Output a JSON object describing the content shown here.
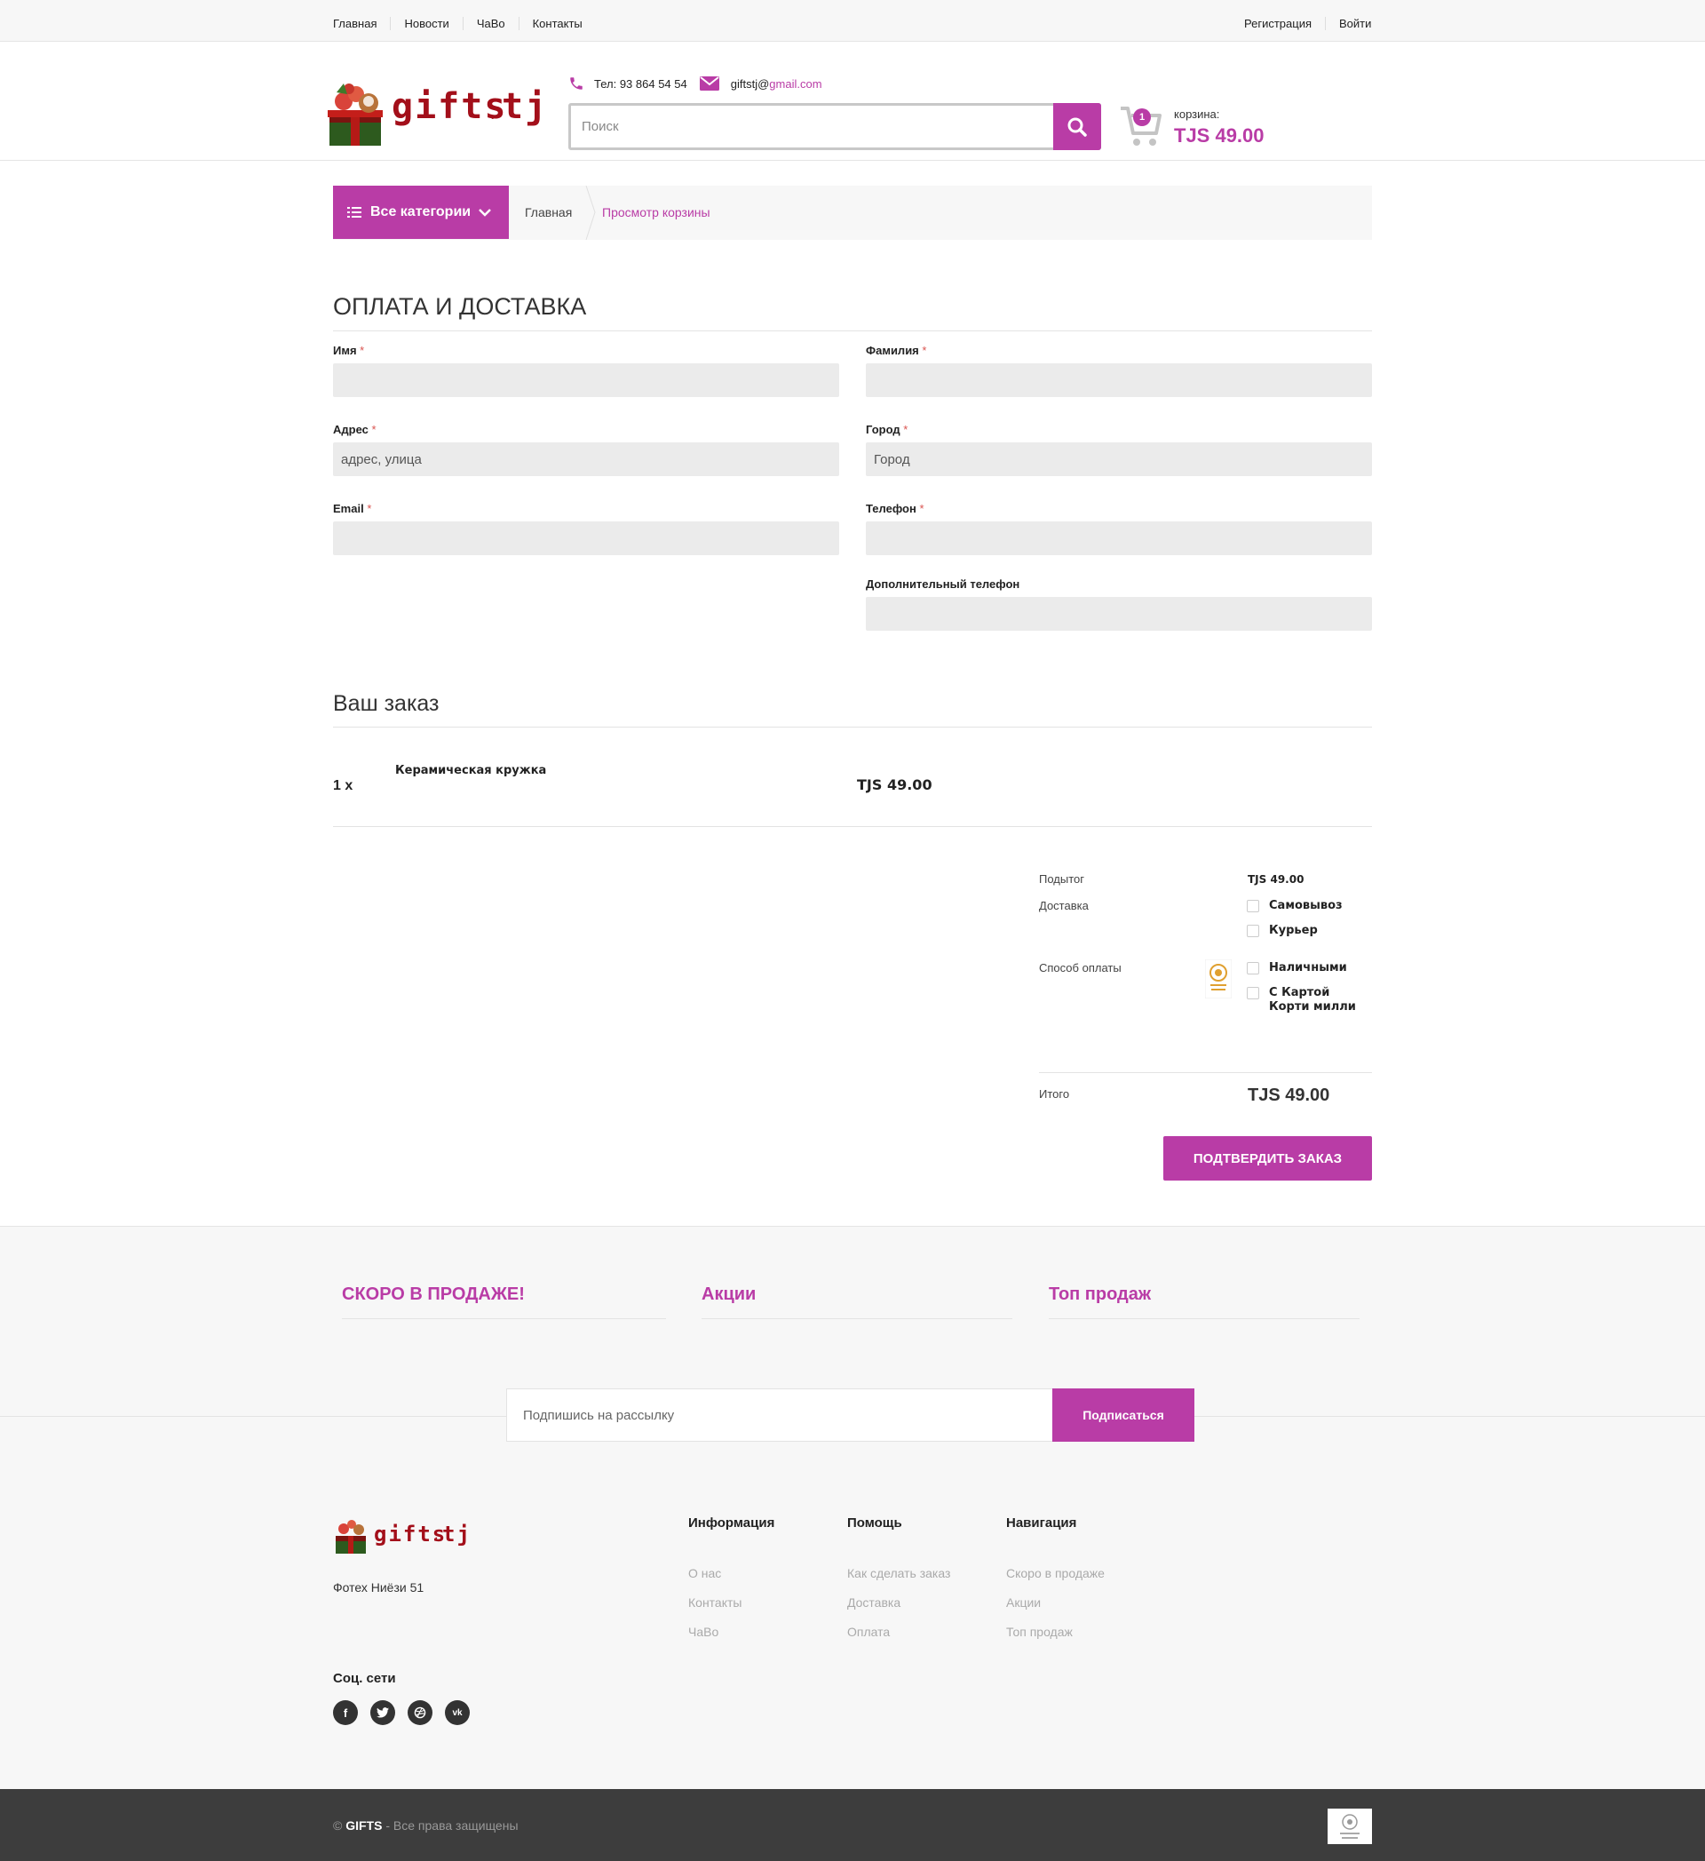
{
  "topbar": {
    "left_links": [
      "Главная",
      "Новости",
      "ЧаВо",
      "Контакты"
    ],
    "right_links": [
      "Регистрация",
      "Войти"
    ]
  },
  "header": {
    "logo_text": "gifts",
    "logo_suffix": "tj",
    "phone": "Тел: 93 864 54 54",
    "email_user": "giftstj@",
    "email_domain": "gmail.com",
    "search_placeholder": "Поиск",
    "cart_count": "1",
    "cart_label": "корзина:",
    "cart_total": "TJS 49.00"
  },
  "breadcrumb": {
    "all_categories": "Все категории",
    "home": "Главная",
    "current": "Просмотр корзины"
  },
  "checkout": {
    "title": "ОПЛАТА И ДОСТАВКА",
    "fields": {
      "first_name": {
        "label": "Имя",
        "value": ""
      },
      "last_name": {
        "label": "Фамилия",
        "value": ""
      },
      "address": {
        "label": "Адрес",
        "placeholder": "адрес, улица"
      },
      "city": {
        "label": "Город",
        "placeholder": "Город"
      },
      "email": {
        "label": "Email",
        "value": ""
      },
      "phone": {
        "label": "Телефон",
        "value": ""
      },
      "extra_phone": {
        "label": "Дополнительный телефон",
        "value": ""
      }
    },
    "required_mark": "*"
  },
  "order": {
    "title": "Ваш заказ",
    "items": [
      {
        "qty": "1 x",
        "name": "Керамическая кружка",
        "price": "TJS 49.00"
      }
    ],
    "summary": {
      "subtotal_label": "Подытог",
      "subtotal_value": "TJS 49.00",
      "delivery_label": "Доставка",
      "delivery_options": [
        "Самовывоз",
        "Курьер"
      ],
      "payment_label": "Способ оплаты",
      "payment_options": [
        "Наличными",
        "С Картой Корти милли"
      ],
      "total_label": "Итого",
      "total_value": "TJS 49.00"
    },
    "confirm_button": "ПОДТВЕРДИТЬ ЗАКАЗ"
  },
  "promo": {
    "headings": [
      "СКОРО В ПРОДАЖЕ!",
      "Акции",
      "Топ продаж"
    ]
  },
  "newsletter": {
    "placeholder": "Подпишись на рассылку",
    "button": "Подписаться"
  },
  "footer": {
    "address": "Фотех Ниёзи 51",
    "social_title": "Соц. сети",
    "social_icons": [
      "facebook-icon",
      "twitter-icon",
      "dribbble-icon",
      "vk-icon"
    ],
    "columns": [
      {
        "title": "Информация",
        "links": [
          "О нас",
          "Контакты",
          "ЧаВо"
        ]
      },
      {
        "title": "Помощь",
        "links": [
          "Как сделать заказ",
          "Доставка",
          "Оплата"
        ]
      },
      {
        "title": "Навигация",
        "links": [
          "Скоро в продаже",
          "Акции",
          "Топ продаж"
        ]
      }
    ],
    "copyright_symbol": "©",
    "brand": "GIFTS",
    "rights": "- Все права защищены"
  },
  "colors": {
    "accent": "#b93ca6",
    "logo_red": "#a30f1a",
    "footer_dark": "#3d3d3d"
  }
}
